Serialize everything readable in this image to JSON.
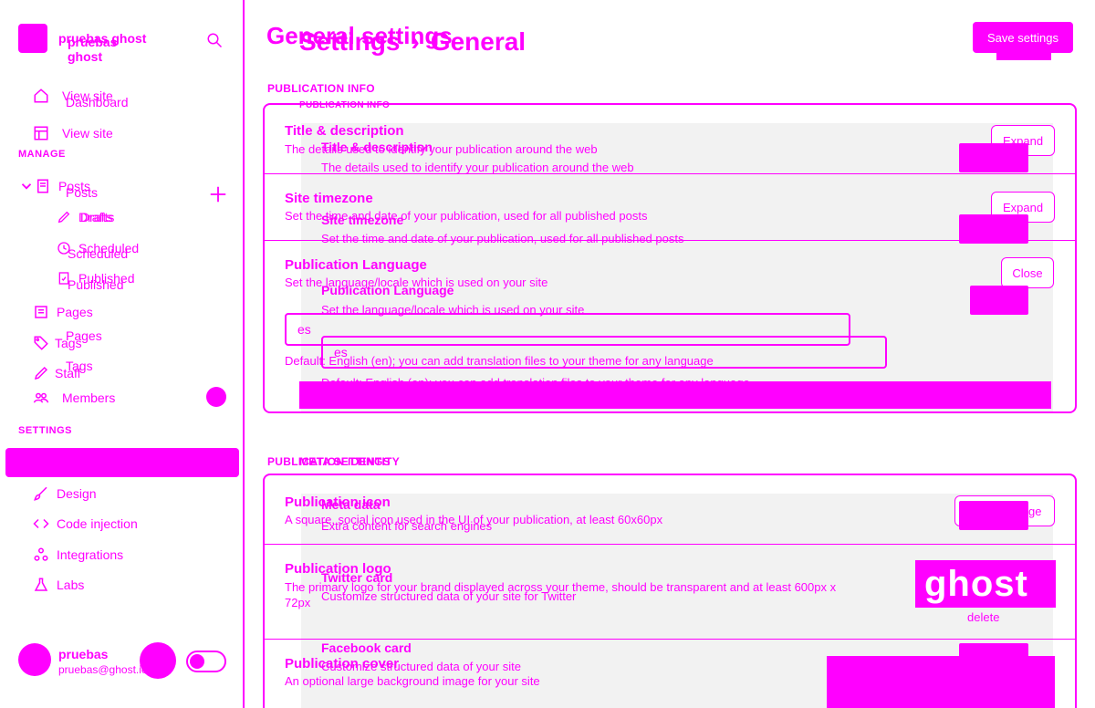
{
  "sidebar": {
    "site_name": "pruebas ghost",
    "site_name_secondary": "pruebas ghost",
    "links_top": {
      "view_site": "View site",
      "dashboard": "Dashboard",
      "view_site_secondary": "View site"
    },
    "section_manage": "MANAGE",
    "posts": "Posts",
    "posts_secondary": "Posts",
    "drafts": "Drafts",
    "drafts_secondary": "Drafts",
    "scheduled": "Scheduled",
    "scheduled_secondary": "Scheduled",
    "published": "Published",
    "published_secondary": "Published",
    "pages": "Pages",
    "pages_secondary": "Pages",
    "tags": "Tags",
    "tags_secondary": "Tags",
    "staff": "Staff",
    "members": "Members",
    "section_settings": "SETTINGS",
    "design": "Design",
    "code_injection": "Code injection",
    "integrations": "Integrations",
    "labs": "Labs",
    "user": {
      "name": "pruebas",
      "email": "pruebas@ghost.io"
    }
  },
  "header": {
    "title": "General settings",
    "breadcrumb_root": "Settings",
    "breadcrumb_sep": "›",
    "breadcrumb_leaf": "General",
    "save_label": "Save settings"
  },
  "publication_info": {
    "section_label": "PUBLICATION INFO",
    "section_label_inner": "PUBLICATION INFO",
    "title_desc": {
      "title": "Title & description",
      "desc": "The details used to identify your publication around the web",
      "title_inner": "Title & description",
      "desc_inner": "The details used to identify your publication around the web",
      "button": "Expand"
    },
    "timezone": {
      "title": "Site timezone",
      "desc": "Set the time and date of your publication, used for all published posts",
      "title_inner": "Site timezone",
      "desc_inner": "Set the time and date of your publication, used for all published posts",
      "button": "Expand"
    },
    "language": {
      "title": "Publication Language",
      "desc": "Set the language/locale which is used on your site",
      "title_inner": "Publication Language",
      "desc_inner": "Set the language/locale which is used on your site",
      "button": "Close",
      "value": "es",
      "value_inner": "es",
      "hint": "Default: English (en); you can add translation files to your theme for any language",
      "hint_inner": "Default: English (en); you can add translation files to your theme for any language"
    }
  },
  "publication_identity": {
    "section_label": "PUBLICATION IDENTITY",
    "section_label_inner": "META SETTINGS",
    "icon": {
      "title": "Publication icon",
      "desc": "A square, social icon used in the UI of your publication, at least 60x60px",
      "title_inner": "Meta data",
      "desc_inner": "Extra content for search engines",
      "button": "Upload Image"
    },
    "logo": {
      "title": "Publication logo",
      "desc": "The primary logo for your brand displayed across your theme, should be transparent and at least 600px x 72px",
      "title_inner": "Twitter card",
      "desc_inner": "Customize structured data of your site for Twitter",
      "logo_text": "ghost",
      "delete": "delete"
    },
    "cover": {
      "title": "Publication cover",
      "desc": "An optional large background image for your site",
      "title_inner": "Facebook card",
      "desc_inner": "Customize structured data of your site"
    }
  },
  "colors": {
    "accent": "#ff00ff",
    "panel": "#f2f2f2"
  }
}
